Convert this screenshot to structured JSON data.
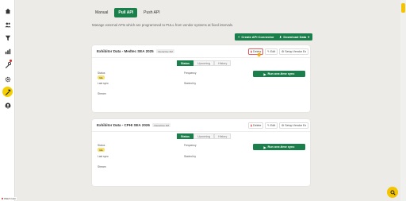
{
  "tabs": [
    {
      "label": "Manual"
    },
    {
      "label": "Pull API"
    },
    {
      "label": "Push API"
    }
  ],
  "description": "Manage external APIs which are programmed to PULL from vendor systems at fixed intervals.",
  "actions": {
    "create_api_connector": "Create API Connector",
    "download_data": "Download Data"
  },
  "cards": [
    {
      "title": "Exhibitor Data - Medtec SEA 2025",
      "badge": "Interactive 3M",
      "delete": "Delete",
      "edit": "Edit",
      "setup_vendor": "Setup Vendor Ex",
      "subtabs": [
        "Status",
        "Upcoming",
        "History"
      ],
      "fields": {
        "status_label": "Status",
        "status_value": "Idle",
        "last_sync_label": "Last sync",
        "frequency_label": "Frequency",
        "started_by_label": "Started by",
        "stream_label": "Stream"
      },
      "run_button": "Run one-time sync"
    },
    {
      "title": "Exhibitor Data - CPHI SEA 2026",
      "badge": "Interactive 3M",
      "delete": "Delete",
      "edit": "Edit",
      "setup_vendor": "Setup Vendor Ex",
      "subtabs": [
        "Status",
        "Upcoming",
        "History"
      ],
      "fields": {
        "status_label": "Status",
        "status_value": "Idle",
        "last_sync_label": "Last sync",
        "frequency_label": "Frequency",
        "started_by_label": "Started by",
        "stream_label": "Stream"
      },
      "run_button": "Run one-time sync"
    }
  ],
  "corner_label": "Watch tutor",
  "colors": {
    "primary_green": "#1b7f4b",
    "accent_yellow": "#f5c400",
    "status_pill": "#f6e27a",
    "background": "#ecebe7"
  },
  "icons": {
    "sidebar": [
      "home-icon",
      "users-icon",
      "filter-icon",
      "report-icon",
      "tools-icon",
      "settings-icon",
      "hammer-icon",
      "user-icon"
    ],
    "fab": "search-icon"
  }
}
